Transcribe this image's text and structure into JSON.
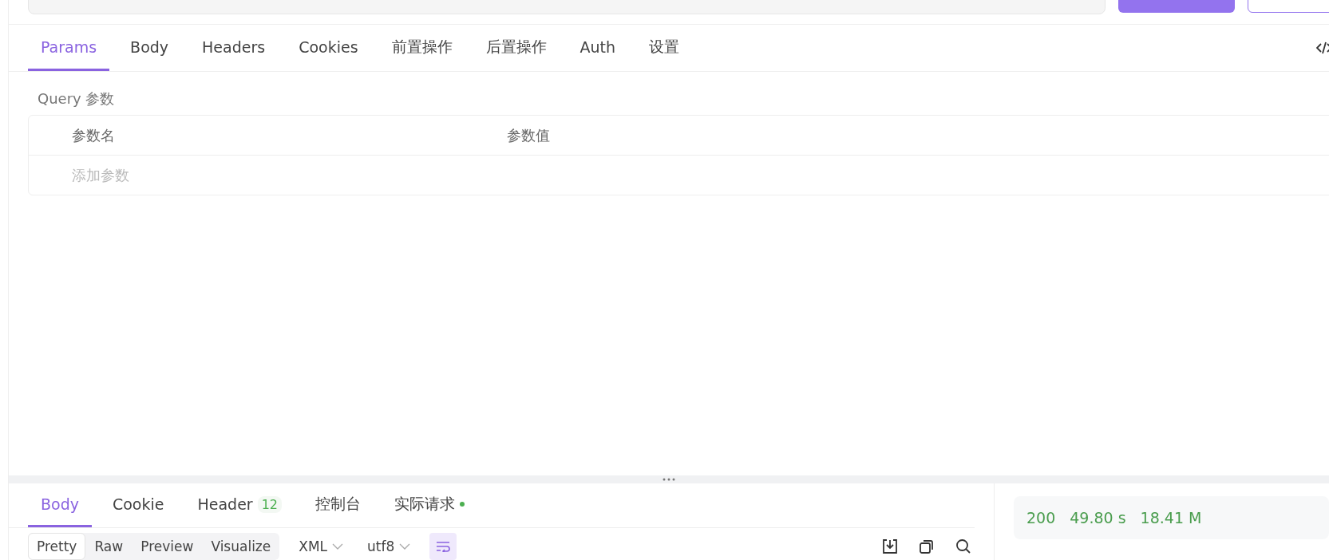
{
  "request_tabs": [
    {
      "label": "Params",
      "selected": true
    },
    {
      "label": "Body",
      "selected": false
    },
    {
      "label": "Headers",
      "selected": false
    },
    {
      "label": "Cookies",
      "selected": false
    },
    {
      "label": "前置操作",
      "selected": false
    },
    {
      "label": "后置操作",
      "selected": false
    },
    {
      "label": "Auth",
      "selected": false
    },
    {
      "label": "设置",
      "selected": false
    }
  ],
  "query_title": "Query 参数",
  "params_table": {
    "columns": [
      "参数名",
      "参数值"
    ],
    "placeholder": "添加参数"
  },
  "response_tabs": [
    {
      "label": "Body",
      "selected": true
    },
    {
      "label": "Cookie",
      "selected": false
    },
    {
      "label": "Header",
      "selected": false,
      "badge": "12"
    },
    {
      "label": "控制台",
      "selected": false
    },
    {
      "label": "实际请求",
      "selected": false,
      "color": "#4caf50"
    }
  ],
  "view_modes": [
    {
      "label": "Pretty",
      "selected": true
    },
    {
      "label": "Raw",
      "selected": false
    },
    {
      "label": "Preview",
      "selected": false
    },
    {
      "label": "Visualize",
      "selected": false
    }
  ],
  "format": "XML",
  "encoding": "utf8",
  "status": {
    "code": "200",
    "time": "49.80 s",
    "size": "18.41 M"
  }
}
